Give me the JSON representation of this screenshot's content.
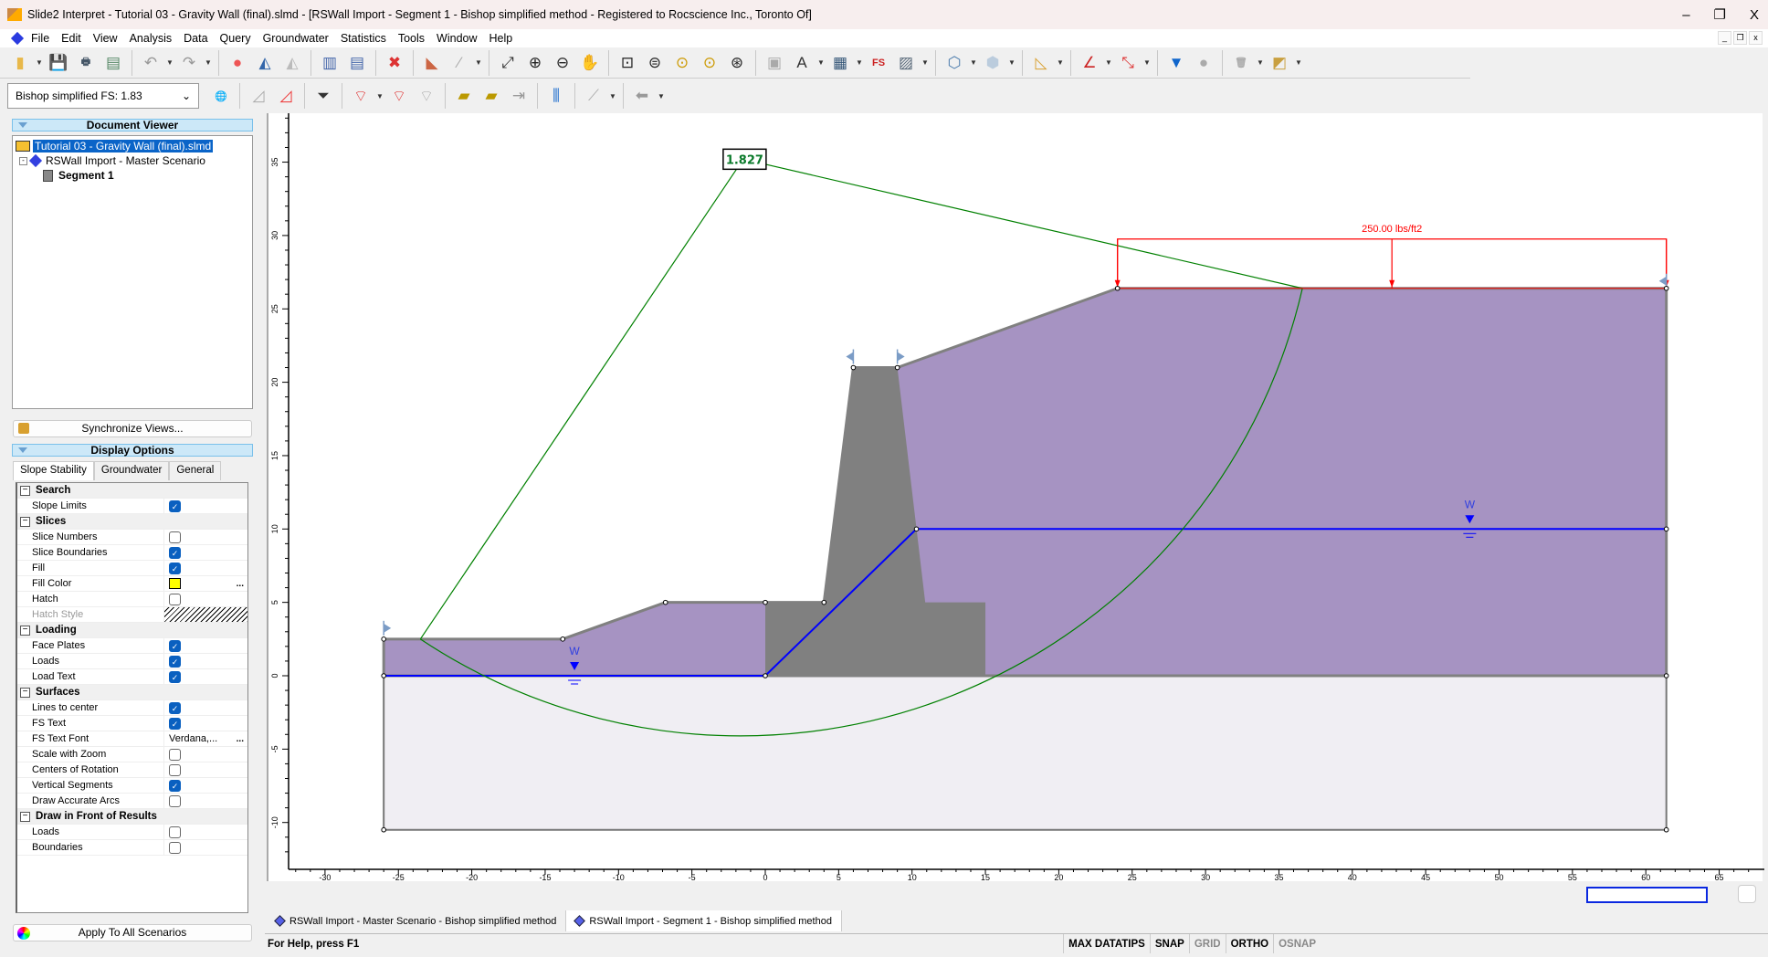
{
  "window": {
    "title": "Slide2 Interpret - Tutorial 03 - Gravity Wall (final).slmd - [RSWall Import - Segment 1 - Bishop simplified method - Registered to Rocscience Inc., Toronto Of]",
    "minimize": "–",
    "restore": "❐",
    "close": "X"
  },
  "menu": [
    "File",
    "Edit",
    "View",
    "Analysis",
    "Data",
    "Query",
    "Groundwater",
    "Statistics",
    "Tools",
    "Window",
    "Help"
  ],
  "mdi_controls": [
    "_",
    "❐",
    "x"
  ],
  "toolbar1": [
    {
      "icon": "open-folder-icon",
      "glyph": "▮",
      "color": "#e8b84a",
      "dd": true
    },
    {
      "icon": "save-icon",
      "glyph": "💾",
      "color": "#345"
    },
    {
      "icon": "print-icon",
      "glyph": "🖶",
      "color": "#456"
    },
    {
      "icon": "print-preview-icon",
      "glyph": "▤",
      "color": "#586"
    },
    {
      "sep": true
    },
    {
      "icon": "undo-icon",
      "glyph": "↶",
      "color": "#999",
      "dd": true
    },
    {
      "icon": "redo-icon",
      "glyph": "↷",
      "color": "#999",
      "dd": true
    },
    {
      "sep": true
    },
    {
      "icon": "color-wheel-icon",
      "glyph": "●",
      "color": "#e55"
    },
    {
      "icon": "contour-icon",
      "glyph": "◭",
      "color": "#36a"
    },
    {
      "icon": "contour-disabled-icon",
      "glyph": "◭",
      "color": "#bbb"
    },
    {
      "sep": true
    },
    {
      "icon": "tile-vertical-icon",
      "glyph": "▥",
      "color": "#46a"
    },
    {
      "icon": "tile-horizontal-icon",
      "glyph": "▤",
      "color": "#46a"
    },
    {
      "sep": true
    },
    {
      "icon": "close-red-icon",
      "glyph": "✖",
      "color": "#d33"
    },
    {
      "sep": true
    },
    {
      "icon": "slope-icon",
      "glyph": "◣",
      "color": "#c64"
    },
    {
      "icon": "grid-line-icon",
      "glyph": "⁄",
      "color": "#aaa",
      "dd": true
    },
    {
      "sep": true
    },
    {
      "icon": "zoom-extents-icon",
      "glyph": "⤢",
      "color": "#333"
    },
    {
      "icon": "zoom-in-icon",
      "glyph": "⊕",
      "color": "#222"
    },
    {
      "icon": "zoom-out-icon",
      "glyph": "⊖",
      "color": "#222"
    },
    {
      "icon": "pan-hand-icon",
      "glyph": "✋",
      "color": "#c96"
    },
    {
      "sep": true
    },
    {
      "icon": "zoom-window-icon",
      "glyph": "⊡",
      "color": "#222"
    },
    {
      "icon": "zoom-scroll-icon",
      "glyph": "⊜",
      "color": "#222"
    },
    {
      "icon": "zoom-previous-icon",
      "glyph": "⊙",
      "color": "#c90"
    },
    {
      "icon": "zoom-bookmark-icon",
      "glyph": "⊙",
      "color": "#c90"
    },
    {
      "icon": "zoom-lock-icon",
      "glyph": "⊛",
      "color": "#222"
    },
    {
      "sep": true
    },
    {
      "icon": "copy-values-icon",
      "glyph": "▣",
      "color": "#aaa"
    },
    {
      "icon": "text-box-icon",
      "glyph": "A",
      "color": "#333",
      "dd": true
    },
    {
      "icon": "table-icon",
      "glyph": "▦",
      "color": "#357",
      "dd": true
    },
    {
      "icon": "fs-icon",
      "glyph": "FS",
      "color": "#c22"
    },
    {
      "icon": "image-icon",
      "glyph": "▨",
      "color": "#567",
      "dd": true
    },
    {
      "sep": true
    },
    {
      "icon": "polygon-icon",
      "glyph": "⬡",
      "color": "#47a",
      "dd": true
    },
    {
      "icon": "hexagon-icon",
      "glyph": "⬢",
      "color": "#bcd",
      "dd": true
    },
    {
      "sep": true
    },
    {
      "icon": "ruler-triangle-icon",
      "glyph": "◺",
      "color": "#d9a030",
      "dd": true
    },
    {
      "sep": true
    },
    {
      "icon": "angle-icon",
      "glyph": "∠",
      "color": "#c22",
      "dd": true
    },
    {
      "icon": "measure-icon",
      "glyph": "⤡",
      "color": "#d33",
      "dd": true
    },
    {
      "sep": true
    },
    {
      "icon": "water-table-icon",
      "glyph": "▼",
      "color": "#16c"
    },
    {
      "icon": "sphere-icon",
      "glyph": "●",
      "color": "#aaa"
    },
    {
      "sep": true
    },
    {
      "icon": "delete-icon",
      "glyph": "🗑",
      "color": "#aaa",
      "dd": true
    },
    {
      "icon": "layers-icon",
      "glyph": "◩",
      "color": "#c9a040",
      "dd": true
    }
  ],
  "toolbar2": {
    "fs_select": "Bishop simplified FS:  1.83",
    "buttons": [
      {
        "icon": "globe-icon",
        "glyph": "🌐",
        "color": "#2a7"
      },
      {
        "sep": true
      },
      {
        "icon": "all-surfaces-icon",
        "glyph": "◿",
        "color": "#aaa"
      },
      {
        "icon": "filter-surfaces-icon",
        "glyph": "◿",
        "color": "#e33"
      },
      {
        "sep": true
      },
      {
        "icon": "funnel-icon",
        "glyph": "⏷",
        "color": "#333"
      },
      {
        "sep": true
      },
      {
        "icon": "add-surface-icon",
        "glyph": "⌔",
        "color": "#d22",
        "dd": true
      },
      {
        "icon": "surface-icon",
        "glyph": "⌔",
        "color": "#d22"
      },
      {
        "icon": "delete-surface-icon",
        "glyph": "⌔",
        "color": "#aaa"
      },
      {
        "sep": true
      },
      {
        "icon": "slice-data-icon",
        "glyph": "▰",
        "color": "#b90"
      },
      {
        "icon": "slice-forces-icon",
        "glyph": "▰",
        "color": "#b90"
      },
      {
        "icon": "slice-arrows-icon",
        "glyph": "⇥",
        "color": "#999"
      },
      {
        "sep": true
      },
      {
        "icon": "graph-icon",
        "glyph": "⫼",
        "color": "#16c"
      },
      {
        "sep": true
      },
      {
        "icon": "query-line-icon",
        "glyph": "⟋",
        "color": "#aaa",
        "dd": true
      },
      {
        "sep": true
      },
      {
        "icon": "flow-arrow-icon",
        "glyph": "⬅",
        "color": "#999",
        "dd": true
      }
    ]
  },
  "document_viewer": {
    "header": "Document Viewer",
    "file": "Tutorial 03 - Gravity Wall (final).slmd",
    "scenario": "RSWall Import - Master Scenario",
    "segment": "Segment 1",
    "sync_button": "Synchronize Views..."
  },
  "display_options": {
    "header": "Display Options",
    "tabs": [
      "Slope Stability",
      "Groundwater",
      "General"
    ],
    "active_tab": 0,
    "groups": [
      {
        "name": "Search",
        "items": [
          {
            "label": "Slope Limits",
            "type": "check",
            "value": true
          }
        ]
      },
      {
        "name": "Slices",
        "items": [
          {
            "label": "Slice Numbers",
            "type": "check",
            "value": false
          },
          {
            "label": "Slice Boundaries",
            "type": "check",
            "value": true
          },
          {
            "label": "Fill",
            "type": "check",
            "value": true
          },
          {
            "label": "Fill Color",
            "type": "color",
            "value": "#ffff00"
          },
          {
            "label": "Hatch",
            "type": "check",
            "value": false
          },
          {
            "label": "Hatch Style",
            "type": "hatch",
            "disabled": true
          }
        ]
      },
      {
        "name": "Loading",
        "items": [
          {
            "label": "Face Plates",
            "type": "check",
            "value": true
          },
          {
            "label": "Loads",
            "type": "check",
            "value": true
          },
          {
            "label": "Load Text",
            "type": "check",
            "value": true
          }
        ]
      },
      {
        "name": "Surfaces",
        "items": [
          {
            "label": "Lines to center",
            "type": "check",
            "value": true
          },
          {
            "label": "FS Text",
            "type": "check",
            "value": true
          },
          {
            "label": "FS Text Font",
            "type": "text",
            "value": "Verdana,..."
          },
          {
            "label": "Scale with Zoom",
            "type": "check",
            "value": false
          },
          {
            "label": "Centers of Rotation",
            "type": "check",
            "value": false
          },
          {
            "label": "Vertical Segments",
            "type": "check",
            "value": true
          },
          {
            "label": "Draw Accurate Arcs",
            "type": "check",
            "value": false
          }
        ]
      },
      {
        "name": "Draw in Front of Results",
        "items": [
          {
            "label": "Loads",
            "type": "check",
            "value": false
          },
          {
            "label": "Boundaries",
            "type": "check",
            "value": false
          }
        ]
      }
    ],
    "apply_button": "Apply To All Scenarios"
  },
  "model": {
    "x_ticks": [
      -30,
      -25,
      -20,
      -15,
      -10,
      -5,
      0,
      5,
      10,
      15,
      20,
      25,
      30,
      35,
      40,
      45,
      50,
      55,
      60,
      65
    ],
    "y_ticks": [
      -10,
      -5,
      0,
      5,
      10,
      15,
      20,
      25,
      30,
      35
    ],
    "soil_polygon": [
      [
        -26,
        0
      ],
      [
        -26,
        2.5
      ],
      [
        -13.8,
        2.5
      ],
      [
        -6.8,
        5
      ],
      [
        4,
        5
      ],
      [
        6,
        21
      ],
      [
        9,
        21
      ],
      [
        24,
        26.4
      ],
      [
        61.4,
        26.4
      ],
      [
        61.4,
        0
      ]
    ],
    "wall_polygon": [
      [
        0,
        0
      ],
      [
        0,
        5
      ],
      [
        4,
        5
      ],
      [
        6,
        21
      ],
      [
        9,
        21
      ],
      [
        10.9,
        5
      ],
      [
        15,
        5
      ],
      [
        15,
        0
      ]
    ],
    "bedrock": [
      [
        -26,
        0
      ],
      [
        61.4,
        0
      ],
      [
        61.4,
        -10.5
      ],
      [
        -26,
        -10.5
      ]
    ],
    "surface_vertices": [
      [
        -26,
        2.5
      ],
      [
        -13.8,
        2.5
      ],
      [
        -6.8,
        5
      ],
      [
        0,
        5
      ],
      [
        4,
        5
      ],
      [
        6,
        21
      ],
      [
        9,
        21
      ],
      [
        24,
        26.4
      ],
      [
        61.4,
        26.4
      ],
      [
        61.4,
        0
      ],
      [
        61.4,
        -10.5
      ],
      [
        -26,
        -10.5
      ],
      [
        -26,
        0
      ],
      [
        0,
        0
      ],
      [
        61.4,
        10
      ],
      [
        10.3,
        10
      ]
    ],
    "water_table": [
      [
        -26,
        0
      ],
      [
        0,
        0
      ],
      [
        10.3,
        10
      ],
      [
        61.4,
        10
      ]
    ],
    "water_markers": [
      {
        "x": -13,
        "y": 0,
        "label": "W"
      },
      {
        "x": 48,
        "y": 10,
        "label": "W"
      }
    ],
    "slip_surface": {
      "center": [
        -1.5,
        35.2
      ],
      "radius": 39.3,
      "entry": [
        -23.5,
        2.5
      ],
      "exit": [
        36.6,
        26.4
      ],
      "fs": "1.827"
    },
    "load": {
      "x1": 24,
      "x2": 61.4,
      "y": 26.4,
      "label": "250.00 lbs/ft2"
    },
    "colors": {
      "soil": "#a693c2",
      "wall": "#808080",
      "bedrock": "#f0eef3",
      "water": "#0000ff",
      "slip": "#008000",
      "load": "#ff0000",
      "limit": "#7b9cc6"
    }
  },
  "doc_tabs": [
    "RSWall Import - Master Scenario - Bishop simplified method",
    "RSWall Import - Segment 1 - Bishop simplified method"
  ],
  "status": {
    "help": "For Help, press F1",
    "items": [
      {
        "label": "MAX DATATIPS",
        "on": true
      },
      {
        "label": "SNAP",
        "on": true
      },
      {
        "label": "GRID",
        "on": false
      },
      {
        "label": "ORTHO",
        "on": true
      },
      {
        "label": "OSNAP",
        "on": false
      }
    ]
  }
}
